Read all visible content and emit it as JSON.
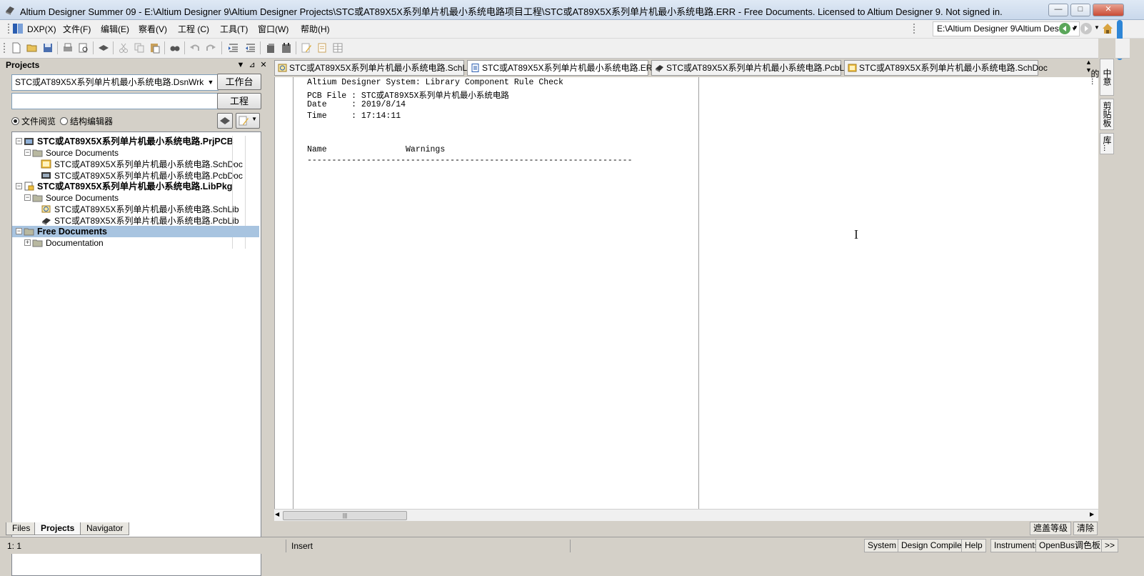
{
  "window": {
    "title": "Altium Designer Summer 09 - E:\\Altium Designer 9\\Altium Designer Projects\\STC或AT89X5X系列单片机最小系统电路项目工程\\STC或AT89X5X系列单片机最小系统电路.ERR - Free Documents. Licensed to Altium Designer 9. Not signed in.",
    "minimize": "—",
    "maximize": "□",
    "close": "✕"
  },
  "menu": {
    "items": [
      "DXP(X)",
      "文件(F)",
      "编辑(E)",
      "察看(V)",
      "工程 (C)",
      "工具(T)",
      "窗口(W)",
      "帮助(H)"
    ],
    "path": "E:\\Altium Designer 9\\Altium Des"
  },
  "projects_panel": {
    "title": "Projects",
    "workspace": "STC或AT89X5X系列单片机最小系统电路.DsnWrk",
    "workspace_button": "工作台",
    "project_input": "",
    "project_button": "工程",
    "radio_file_view": "文件阅览",
    "radio_structure_editor": "结构编辑器",
    "tree": [
      {
        "label": "STC或AT89X5X系列单片机最小系统电路.PrjPCB"
      },
      {
        "label": "Source Documents"
      },
      {
        "label": "STC或AT89X5X系列单片机最小系统电路.SchDoc"
      },
      {
        "label": "STC或AT89X5X系列单片机最小系统电路.PcbDoc"
      },
      {
        "label": "STC或AT89X5X系列单片机最小系统电路.LibPkg"
      },
      {
        "label": "Source Documents"
      },
      {
        "label": "STC或AT89X5X系列单片机最小系统电路.SchLib"
      },
      {
        "label": "STC或AT89X5X系列单片机最小系统电路.PcbLib"
      },
      {
        "label": "Free Documents"
      },
      {
        "label": "Documentation"
      }
    ],
    "tabs": [
      "Files",
      "Projects",
      "Navigator"
    ]
  },
  "doc_tabs": [
    {
      "label": "STC或AT89X5X系列单片机最小系统电路.SchLib"
    },
    {
      "label": "STC或AT89X5X系列单片机最小系统电路.ERR"
    },
    {
      "label": "STC或AT89X5X系列单片机最小系统电路.PcbLib"
    },
    {
      "label": "STC或AT89X5X系列单片机最小系统电路.SchDoc"
    }
  ],
  "report": {
    "line1": "Altium Designer System: Library Component Rule Check",
    "line2": "PCB File : STC或AT89X5X系列单片机最小系统电路",
    "line3": "Date     : 2019/8/14",
    "line4": "Time     : 17:14:11",
    "line5": "Name                Warnings",
    "line6": "------------------------------------------------------------------"
  },
  "right_tabs": [
    "中意的...",
    "剪贴板",
    "库..."
  ],
  "command_bar": {
    "mask_level": "遮盖等级",
    "clear": "清除"
  },
  "status": {
    "position": "1: 1",
    "mode": "Insert",
    "buttons": [
      "System",
      "Design Compiler",
      "Help",
      "Instruments",
      "OpenBus调色板",
      ">>"
    ]
  }
}
